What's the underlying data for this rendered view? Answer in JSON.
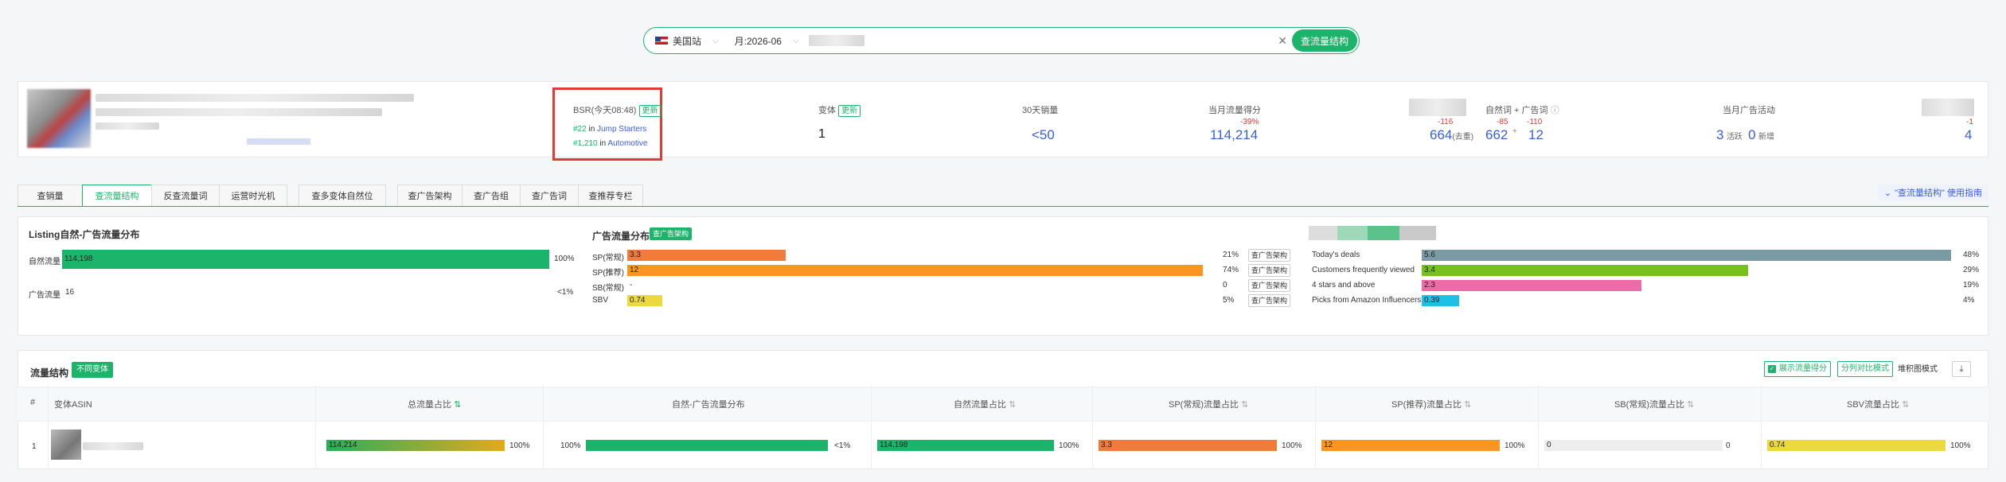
{
  "search": {
    "site": "美国站",
    "month": "月:2026-06",
    "button": "查流量结构"
  },
  "product": {
    "bsr": {
      "label": "BSR(今天08:48)",
      "update_tag": "更新",
      "rank1": "#22",
      "rank1_in": "in",
      "rank1_cat": "Jump Starters",
      "rank2": "#1,210",
      "rank2_in": "in",
      "rank2_cat": "Automotive"
    },
    "variants": {
      "label": "变体",
      "tag": "更新",
      "value": "1"
    },
    "sales30": {
      "label": "30天销量",
      "value": "<50"
    },
    "traffic_score": {
      "label": "当月流量得分",
      "change": "-39%",
      "value": "114,214"
    },
    "kw_blur": {
      "change": "-116",
      "value": "664",
      "suffix": "(去重)"
    },
    "natural_ad_kw": {
      "label": "自然词 + 广告词",
      "natural_change": "-85",
      "natural_value": "662",
      "plus": "+",
      "ad_change": "-110",
      "ad_value": "12"
    },
    "ad_activity": {
      "label": "当月广告活动",
      "count": "3",
      "count_sub": "活跃",
      "new": "0",
      "new_sub": "新增"
    },
    "last": {
      "change": "-1",
      "value": "4"
    }
  },
  "tabs": [
    {
      "label": "查销量"
    },
    {
      "label": "查流量结构"
    },
    {
      "label": "反查流量词"
    },
    {
      "label": "运营时光机"
    },
    {
      "label": "查多变体自然位"
    },
    {
      "label": "查广告架构"
    },
    {
      "label": "查广告组"
    },
    {
      "label": "查广告词"
    },
    {
      "label": "查推荐专栏"
    }
  ],
  "guide": "\"查流量结构\" 使用指南",
  "listing": {
    "title": "Listing自然-广告流量分布",
    "rows": [
      {
        "label": "自然流量",
        "value": "114,198",
        "pct": "100%",
        "share": 1.0
      },
      {
        "label": "广告流量",
        "value": "16",
        "pct": "<1%",
        "share": 0.0
      }
    ]
  },
  "ad_dist": {
    "title": "广告流量分布",
    "tag": "查广告架构",
    "btn": "查广告架构",
    "rows": [
      {
        "label": "SP(常规)",
        "value": "3.3",
        "pct": "21%",
        "share": 0.27,
        "color": "#f07b3a"
      },
      {
        "label": "SP(推荐)",
        "value": "12",
        "pct": "74%",
        "share": 0.98,
        "color": "#fb9522"
      },
      {
        "label": "SB(常规)",
        "value": "-",
        "pct": "0",
        "share": 0,
        "color": "#cccccc"
      },
      {
        "label": "SBV",
        "value": "0.74",
        "pct": "5%",
        "share": 0.06,
        "color": "#ecd93f"
      }
    ]
  },
  "rec_dist": {
    "rows": [
      {
        "label": "Today's deals",
        "value": "5.6",
        "pct": "48%",
        "share": 0.99,
        "color": "#7a9ba3"
      },
      {
        "label": "Customers frequently viewed",
        "value": "3.4",
        "pct": "29%",
        "share": 0.61,
        "color": "#76c11d"
      },
      {
        "label": "4 stars and above",
        "value": "2.3",
        "pct": "19%",
        "share": 0.41,
        "color": "#ee6aa8"
      },
      {
        "label": "Picks from Amazon Influencers",
        "value": "0.39",
        "pct": "4%",
        "share": 0.07,
        "color": "#1fc0e6"
      }
    ]
  },
  "table": {
    "title": "流量结构",
    "tag": "不同变体",
    "show_score": "展示流量得分",
    "mode1": "分列对比模式",
    "mode2": "堆积图模式",
    "headers": {
      "idx": "#",
      "asin": "变体ASIN",
      "total": "总流量占比",
      "nat_ad": "自然-广告流量分布",
      "natural": "自然流量占比",
      "sp_reg": "SP(常规)流量占比",
      "sp_rec": "SP(推荐)流量占比",
      "sb_reg": "SB(常规)流量占比",
      "sbv": "SBV流量占比"
    },
    "row": {
      "idx": "1",
      "total_value": "114,214",
      "total_pct": "100%",
      "nat_left": "100%",
      "nat_right": "<1%",
      "natural_value": "114,198",
      "natural_pct": "100%",
      "sp_reg_value": "3.3",
      "sp_reg_pct": "100%",
      "sp_rec_value": "12",
      "sp_rec_pct": "100%",
      "sb_reg_value": "0",
      "sb_reg_pct": "0",
      "sbv_value": "0.74",
      "sbv_pct": "100%"
    }
  },
  "icons": [
    "flag-icon",
    "chevron-down-icon",
    "close-icon",
    "download-icon",
    "sort-icon",
    "help-icon",
    "checkbox-icon"
  ]
}
